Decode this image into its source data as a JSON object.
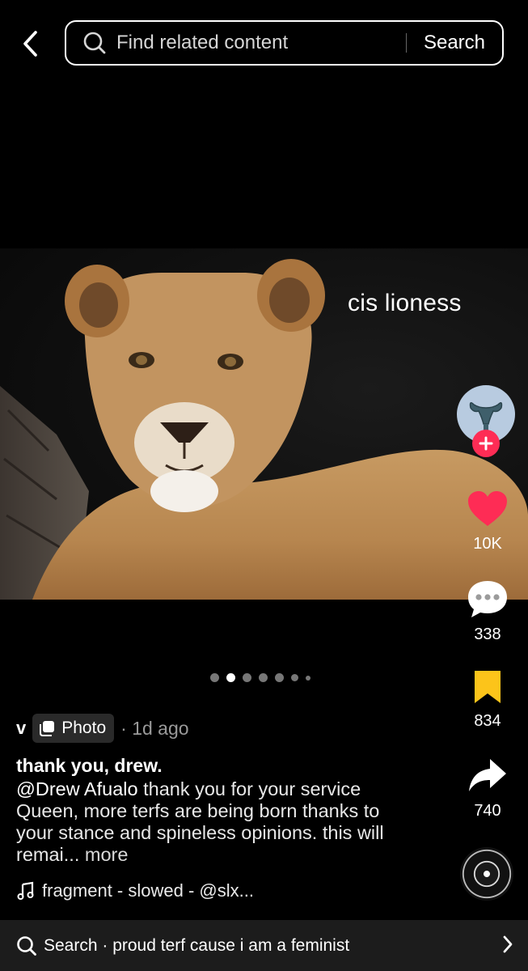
{
  "header": {
    "search_placeholder": "Find related content",
    "search_button": "Search"
  },
  "photo": {
    "caption": "cis lioness",
    "carousel": {
      "count": 7,
      "active_index": 1
    }
  },
  "actions": {
    "likes": "10K",
    "comments": "338",
    "saves": "834",
    "shares": "740"
  },
  "post": {
    "author": "v",
    "type_badge": "Photo",
    "time": "· 1d ago",
    "title": "thank you, drew.",
    "mention": "@Drew Afualo",
    "description": " thank you for your service Queen, more terfs are being born thanks to your stance and spineless opinions. this will remai...",
    "more_label": "more",
    "music": "fragment - slowed - @slx..."
  },
  "bottom_search": {
    "label": "Search · proud terf cause i am a feminist"
  },
  "colors": {
    "accent_red": "#fe2c55",
    "like_red": "#fe2c55",
    "save_yellow": "#fcc41a"
  }
}
